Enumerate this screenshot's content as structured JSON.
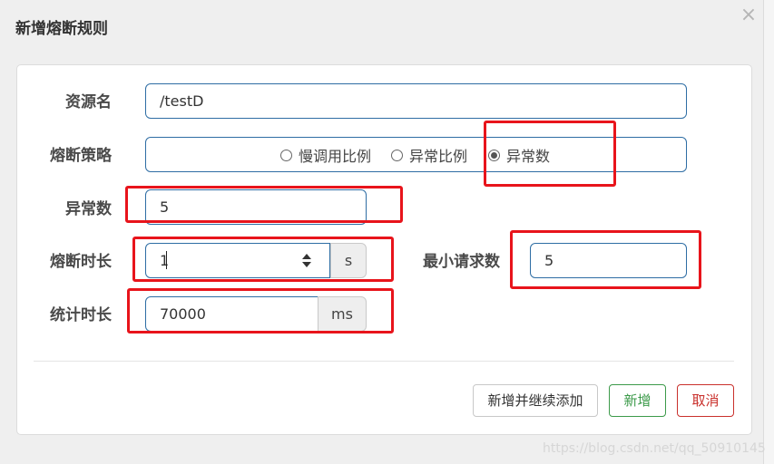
{
  "dialog": {
    "title": "新增熔断规则",
    "close_symbol": "×"
  },
  "form": {
    "resource": {
      "label": "资源名",
      "value": "/testD"
    },
    "strategy": {
      "label": "熔断策略",
      "options": [
        {
          "label": "慢调用比例",
          "checked": false
        },
        {
          "label": "异常比例",
          "checked": false
        },
        {
          "label": "异常数",
          "checked": true
        }
      ]
    },
    "exception_count": {
      "label": "异常数",
      "value": "5"
    },
    "break_duration": {
      "label": "熔断时长",
      "value": "1",
      "unit": "s"
    },
    "min_requests": {
      "label": "最小请求数",
      "value": "5"
    },
    "stat_duration": {
      "label": "统计时长",
      "value": "70000",
      "unit": "ms"
    }
  },
  "footer": {
    "add_continue_label": "新增并继续添加",
    "add_label": "新增",
    "cancel_label": "取消"
  },
  "watermark": "https://blog.csdn.net/qq_50910145",
  "colors": {
    "input_border": "#2e6da4",
    "highlight_red": "#e8141b",
    "success": "#3c9a4a",
    "danger": "#c9302c"
  }
}
